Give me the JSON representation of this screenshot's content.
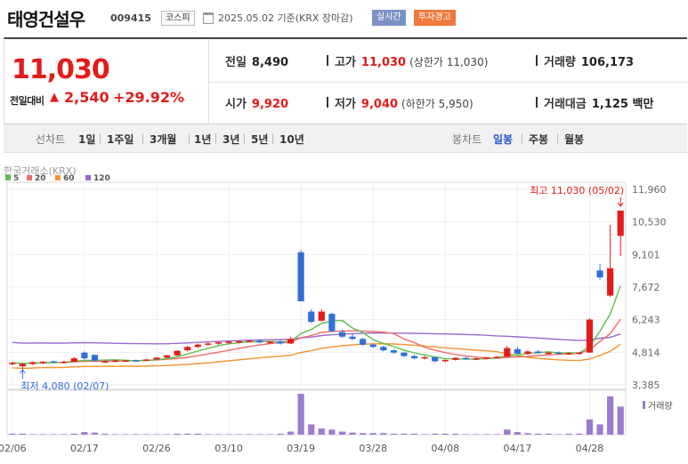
{
  "header": {
    "name": "태영건설우",
    "code": "009415",
    "market": "코스피",
    "asof": "2025.05.02  기준(KRX 장마감)",
    "realtime": "실시간",
    "warning": "투자경고"
  },
  "quote": {
    "price": "11,030",
    "change_label": "전일대비",
    "change": "2,540",
    "change_pct": "+29.92%",
    "prev_label": "전일",
    "prev": "8,490",
    "high_label": "고가",
    "high": "11,030",
    "upper_limit": "(상한가 11,030)",
    "volume_label": "거래량",
    "volume": "106,173",
    "open_label": "시가",
    "open": "9,920",
    "low_label": "저가",
    "low": "9,040",
    "lower_limit": "(하한가 5,950)",
    "amount_label": "거래대금",
    "amount": "1,125 백만"
  },
  "toolbar": {
    "line_chart": "선차트",
    "periods": [
      "1일",
      "1주일",
      "3개월",
      "1년",
      "3년",
      "5년",
      "10년"
    ],
    "candle_chart": "봉차트",
    "candle_periods": [
      "일봉",
      "주봉",
      "월봉"
    ]
  },
  "exchange_label": "한국거래소(KRX)",
  "colors": {
    "up": "#e31b1b",
    "down": "#2f6fd8",
    "ma5": "#5cbf4a",
    "ma20": "#f06a6a",
    "ma60": "#f3922c",
    "ma120": "#9c6ad0"
  },
  "chart_data": {
    "type": "candlestick",
    "ylim": [
      3385,
      11960
    ],
    "yticks": [
      "11,960",
      "10,530",
      "9,101",
      "7,672",
      "6,243",
      "4,814",
      "3,385"
    ],
    "xticks": [
      "02/06",
      "02/17",
      "02/26",
      "03/10",
      "03/19",
      "03/28",
      "04/08",
      "04/17",
      "04/28"
    ],
    "xtick_index": [
      0,
      7,
      14,
      21,
      28,
      35,
      42,
      49,
      56
    ],
    "legend": [
      "5",
      "20",
      "60",
      "120"
    ],
    "annotations": {
      "high": "최고 11,030 (05/02)",
      "low": "최저 4,080 (02/07)"
    },
    "volume_label": "거래량",
    "candles": [
      {
        "d": "02/06",
        "o": 4300,
        "h": 4400,
        "l": 4250,
        "c": 4350
      },
      {
        "d": "02/07",
        "o": 4200,
        "h": 4350,
        "l": 4080,
        "c": 4300
      },
      {
        "d": "02/10",
        "o": 4300,
        "h": 4420,
        "l": 4250,
        "c": 4380
      },
      {
        "d": "02/11",
        "o": 4380,
        "h": 4430,
        "l": 4300,
        "c": 4400
      },
      {
        "d": "02/12",
        "o": 4420,
        "h": 4450,
        "l": 4350,
        "c": 4380
      },
      {
        "d": "02/13",
        "o": 4380,
        "h": 4450,
        "l": 4320,
        "c": 4400
      },
      {
        "d": "02/14",
        "o": 4400,
        "h": 4600,
        "l": 4380,
        "c": 4550
      },
      {
        "d": "02/17",
        "o": 4800,
        "h": 4850,
        "l": 4500,
        "c": 4550
      },
      {
        "d": "02/18",
        "o": 4700,
        "h": 4720,
        "l": 4400,
        "c": 4450
      },
      {
        "d": "02/19",
        "o": 4400,
        "h": 4460,
        "l": 4350,
        "c": 4420
      },
      {
        "d": "02/20",
        "o": 4420,
        "h": 4480,
        "l": 4380,
        "c": 4450
      },
      {
        "d": "02/21",
        "o": 4420,
        "h": 4480,
        "l": 4400,
        "c": 4460
      },
      {
        "d": "02/24",
        "o": 4460,
        "h": 4500,
        "l": 4400,
        "c": 4450
      },
      {
        "d": "02/25",
        "o": 4450,
        "h": 4520,
        "l": 4420,
        "c": 4500
      },
      {
        "d": "02/26",
        "o": 4500,
        "h": 4600,
        "l": 4450,
        "c": 4580
      },
      {
        "d": "02/27",
        "o": 4580,
        "h": 4700,
        "l": 4550,
        "c": 4680
      },
      {
        "d": "02/28",
        "o": 4680,
        "h": 4900,
        "l": 4650,
        "c": 4880
      },
      {
        "d": "03/04",
        "o": 4900,
        "h": 5100,
        "l": 4850,
        "c": 5050
      },
      {
        "d": "03/05",
        "o": 5050,
        "h": 5200,
        "l": 5000,
        "c": 5150
      },
      {
        "d": "03/06",
        "o": 5150,
        "h": 5250,
        "l": 5100,
        "c": 5200
      },
      {
        "d": "03/07",
        "o": 5200,
        "h": 5300,
        "l": 5150,
        "c": 5250
      },
      {
        "d": "03/10",
        "o": 5250,
        "h": 5320,
        "l": 5180,
        "c": 5280
      },
      {
        "d": "03/11",
        "o": 5280,
        "h": 5350,
        "l": 5200,
        "c": 5300
      },
      {
        "d": "03/12",
        "o": 5300,
        "h": 5380,
        "l": 5250,
        "c": 5320
      },
      {
        "d": "03/13",
        "o": 5320,
        "h": 5380,
        "l": 5200,
        "c": 5250
      },
      {
        "d": "03/14",
        "o": 5250,
        "h": 5320,
        "l": 5200,
        "c": 5280
      },
      {
        "d": "03/17",
        "o": 5280,
        "h": 5350,
        "l": 5150,
        "c": 5200
      },
      {
        "d": "03/18",
        "o": 5200,
        "h": 5500,
        "l": 5180,
        "c": 5400
      },
      {
        "d": "03/19",
        "o": 9200,
        "h": 9300,
        "l": 7050,
        "c": 7050
      },
      {
        "d": "03/20",
        "o": 6600,
        "h": 6700,
        "l": 6100,
        "c": 6150
      },
      {
        "d": "03/21",
        "o": 6200,
        "h": 6700,
        "l": 6150,
        "c": 6600
      },
      {
        "d": "03/24",
        "o": 6500,
        "h": 6550,
        "l": 5700,
        "c": 5750
      },
      {
        "d": "03/25",
        "o": 5700,
        "h": 5800,
        "l": 5450,
        "c": 5500
      },
      {
        "d": "03/26",
        "o": 5500,
        "h": 5650,
        "l": 5350,
        "c": 5400
      },
      {
        "d": "03/27",
        "o": 5400,
        "h": 5450,
        "l": 5100,
        "c": 5150
      },
      {
        "d": "03/28",
        "o": 5150,
        "h": 5200,
        "l": 5000,
        "c": 5050
      },
      {
        "d": "03/31",
        "o": 5050,
        "h": 5100,
        "l": 4850,
        "c": 4900
      },
      {
        "d": "04/01",
        "o": 4900,
        "h": 4950,
        "l": 4750,
        "c": 4800
      },
      {
        "d": "04/02",
        "o": 4800,
        "h": 4850,
        "l": 4600,
        "c": 4650
      },
      {
        "d": "04/03",
        "o": 4650,
        "h": 4700,
        "l": 4500,
        "c": 4550
      },
      {
        "d": "04/04",
        "o": 4550,
        "h": 4650,
        "l": 4500,
        "c": 4600
      },
      {
        "d": "04/07",
        "o": 4600,
        "h": 4620,
        "l": 4380,
        "c": 4420
      },
      {
        "d": "04/08",
        "o": 4420,
        "h": 4500,
        "l": 4380,
        "c": 4480
      },
      {
        "d": "04/09",
        "o": 4480,
        "h": 4600,
        "l": 4450,
        "c": 4570
      },
      {
        "d": "04/10",
        "o": 4570,
        "h": 4620,
        "l": 4480,
        "c": 4520
      },
      {
        "d": "04/11",
        "o": 4520,
        "h": 4580,
        "l": 4480,
        "c": 4550
      },
      {
        "d": "04/14",
        "o": 4550,
        "h": 4600,
        "l": 4500,
        "c": 4580
      },
      {
        "d": "04/15",
        "o": 4580,
        "h": 4650,
        "l": 4550,
        "c": 4620
      },
      {
        "d": "04/16",
        "o": 4620,
        "h": 5100,
        "l": 4600,
        "c": 5000
      },
      {
        "d": "04/17",
        "o": 4950,
        "h": 5050,
        "l": 4700,
        "c": 4750
      },
      {
        "d": "04/18",
        "o": 4750,
        "h": 4900,
        "l": 4700,
        "c": 4850
      },
      {
        "d": "04/21",
        "o": 4850,
        "h": 4900,
        "l": 4750,
        "c": 4780
      },
      {
        "d": "04/22",
        "o": 4780,
        "h": 4850,
        "l": 4720,
        "c": 4800
      },
      {
        "d": "04/23",
        "o": 4800,
        "h": 4850,
        "l": 4720,
        "c": 4750
      },
      {
        "d": "04/24",
        "o": 4750,
        "h": 4820,
        "l": 4700,
        "c": 4780
      },
      {
        "d": "04/25",
        "o": 4780,
        "h": 4830,
        "l": 4700,
        "c": 4800
      },
      {
        "d": "04/28",
        "o": 4800,
        "h": 6300,
        "l": 4800,
        "c": 6250
      },
      {
        "d": "04/29",
        "o": 8400,
        "h": 8700,
        "l": 8000,
        "c": 8100
      },
      {
        "d": "04/30",
        "o": 7300,
        "h": 10400,
        "l": 7250,
        "c": 8500
      },
      {
        "d": "05/02",
        "o": 9920,
        "h": 11030,
        "l": 9040,
        "c": 11030
      }
    ],
    "volumes": [
      2,
      2,
      1,
      1,
      1,
      1,
      2,
      5,
      4,
      2,
      1,
      1,
      1,
      1,
      1,
      1,
      2,
      2,
      2,
      1,
      1,
      1,
      1,
      1,
      1,
      1,
      2,
      6,
      80,
      20,
      12,
      10,
      6,
      4,
      3,
      3,
      3,
      2,
      2,
      2,
      1,
      2,
      2,
      2,
      1,
      1,
      1,
      1,
      10,
      5,
      3,
      2,
      2,
      1,
      2,
      2,
      30,
      20,
      75,
      55
    ]
  }
}
